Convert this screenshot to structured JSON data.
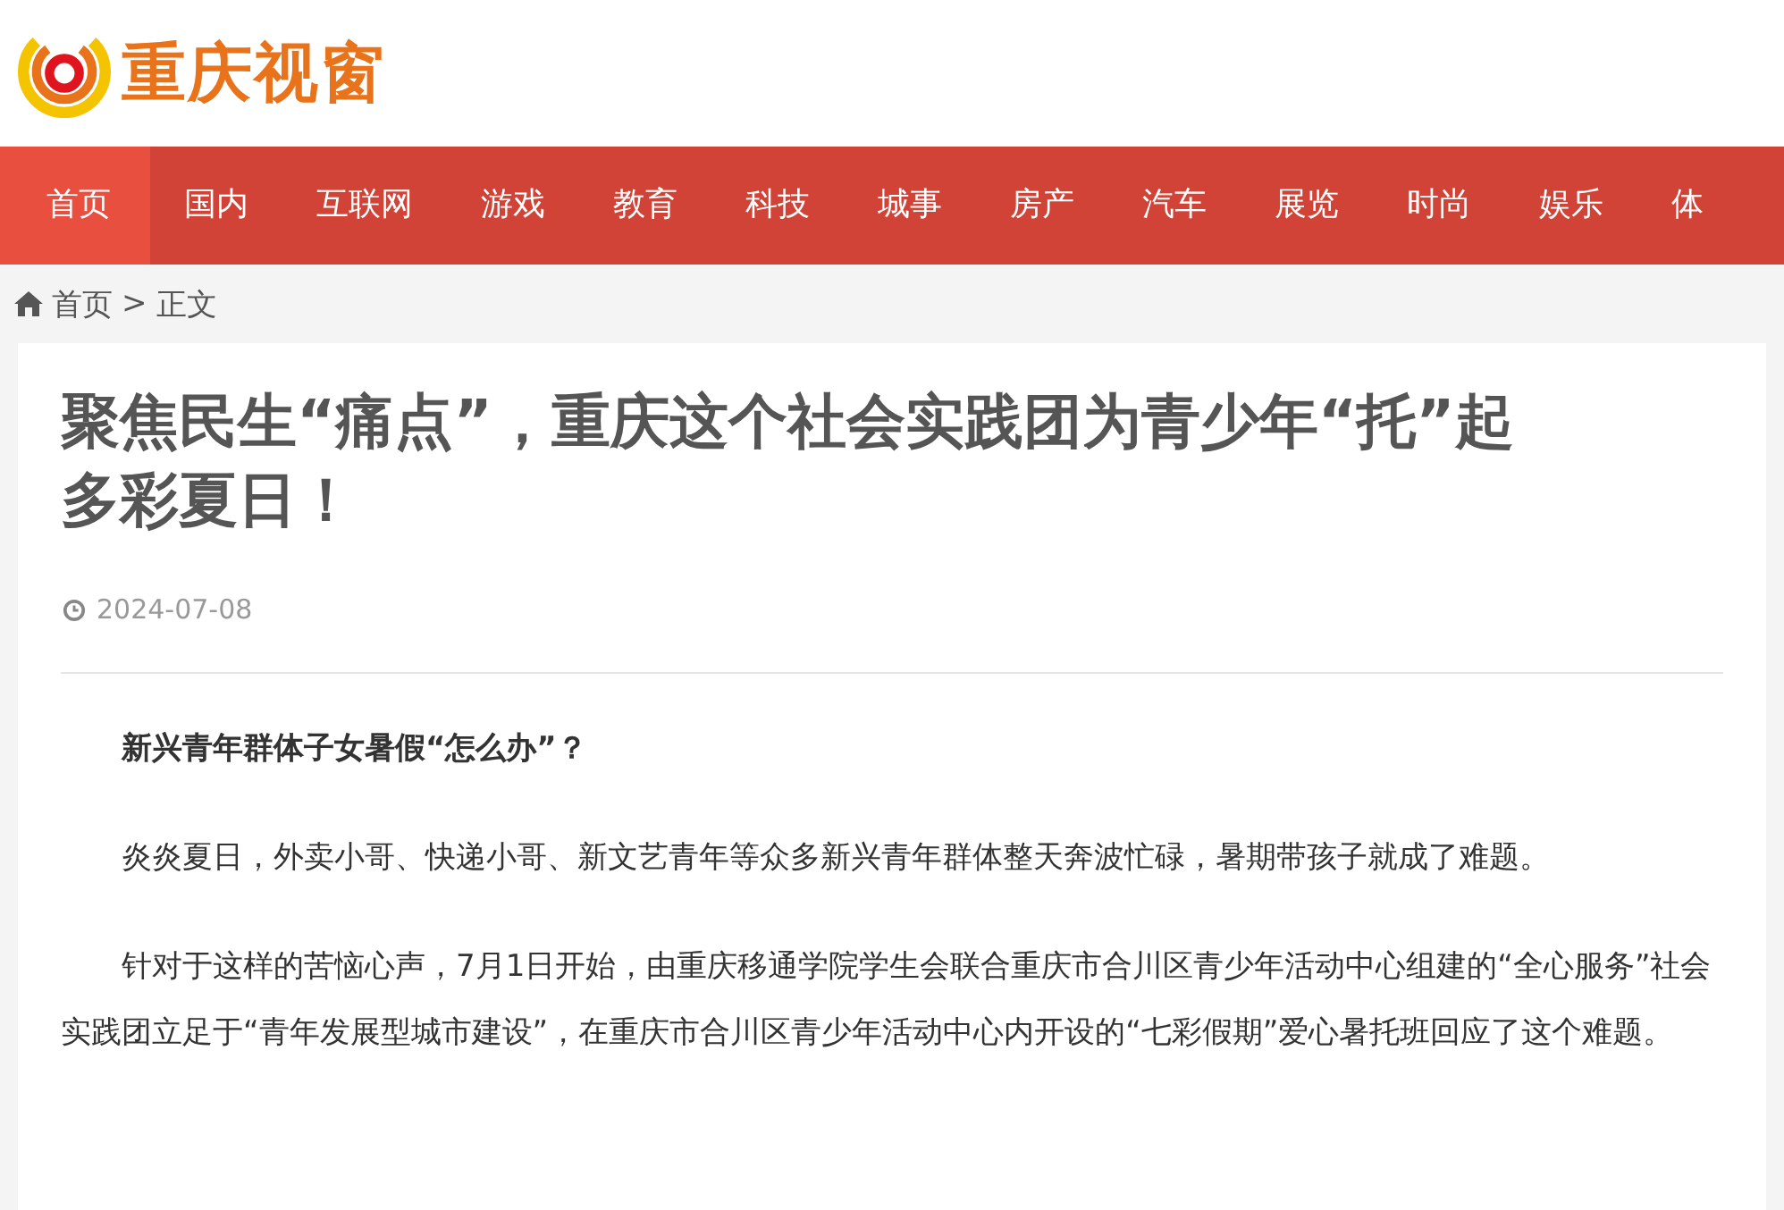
{
  "logo": {
    "text": "重庆视窗"
  },
  "nav": [
    {
      "label": "首页",
      "selected": true
    },
    {
      "label": "国内",
      "selected": false
    },
    {
      "label": "互联网",
      "selected": false
    },
    {
      "label": "游戏",
      "selected": false
    },
    {
      "label": "教育",
      "selected": false
    },
    {
      "label": "科技",
      "selected": false
    },
    {
      "label": "城事",
      "selected": false
    },
    {
      "label": "房产",
      "selected": false
    },
    {
      "label": "汽车",
      "selected": false
    },
    {
      "label": "展览",
      "selected": false
    },
    {
      "label": "时尚",
      "selected": false
    },
    {
      "label": "娱乐",
      "selected": false
    },
    {
      "label": "体",
      "selected": false
    }
  ],
  "breadcrumb": [
    "首页",
    "正文"
  ],
  "breadcrumb_separator": ">",
  "article": {
    "title": "聚焦民生“痛点”，重庆这个社会实践团为青少年“托”起多彩夏日！",
    "date": "2024-07-08",
    "paragraphs": [
      {
        "kind": "heading",
        "text": "新兴青年群体子女暑假“怎么办”？"
      },
      {
        "kind": "body",
        "text": "炎炎夏日，外卖小哥、快递小哥、新文艺青年等众多新兴青年群体整天奔波忙碌，暑期带孩子就成了难题。"
      },
      {
        "kind": "body",
        "text": "针对于这样的苦恼心声，7月1日开始，由重庆移通学院学生会联合重庆市合川区青少年活动中心组建的“全心服务”社会实践团立足于“青年发展型城市建设”，在重庆市合川区青少年活动中心内开设的“七彩假期”爱心暑托班回应了这个难题。"
      }
    ]
  }
}
